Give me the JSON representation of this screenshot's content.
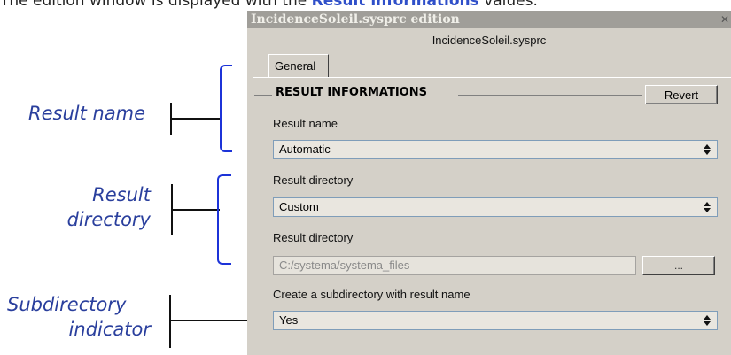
{
  "caption": {
    "prefix": "The edition window is displayed with the",
    "link": "Result informations",
    "suffix": "values."
  },
  "annotations": {
    "result_name": "Result name",
    "result_directory_line1": "Result",
    "result_directory_line2": "directory",
    "subdirectory_line1": "Subdirectory",
    "subdirectory_line2": "indicator"
  },
  "dialog": {
    "title": "IncidenceSoleil.sysprc edition",
    "close_glyph": "✕",
    "subtitle": "IncidenceSoleil.sysprc",
    "tabs": [
      {
        "label": "General",
        "active": true
      }
    ],
    "group_title": "RESULT INFORMATIONS",
    "revert_label": "Revert",
    "result_name_label": "Result name",
    "result_name_value": "Automatic",
    "result_directory_label": "Result directory",
    "result_directory_value": "Custom",
    "result_directory_path_label": "Result directory",
    "result_directory_path_value": "C:/systema/systema_files",
    "browse_label": "...",
    "subdirectory_label": "Create a subdirectory with result name",
    "subdirectory_value": "Yes"
  },
  "colors": {
    "annotation_text": "#2a3f9d",
    "bracket": "#1c33d8",
    "caption_link": "#2f4fc9",
    "dialog_bg": "#d4d0c8"
  },
  "icons": {
    "select_arrow": "up-down-arrow-icon"
  }
}
